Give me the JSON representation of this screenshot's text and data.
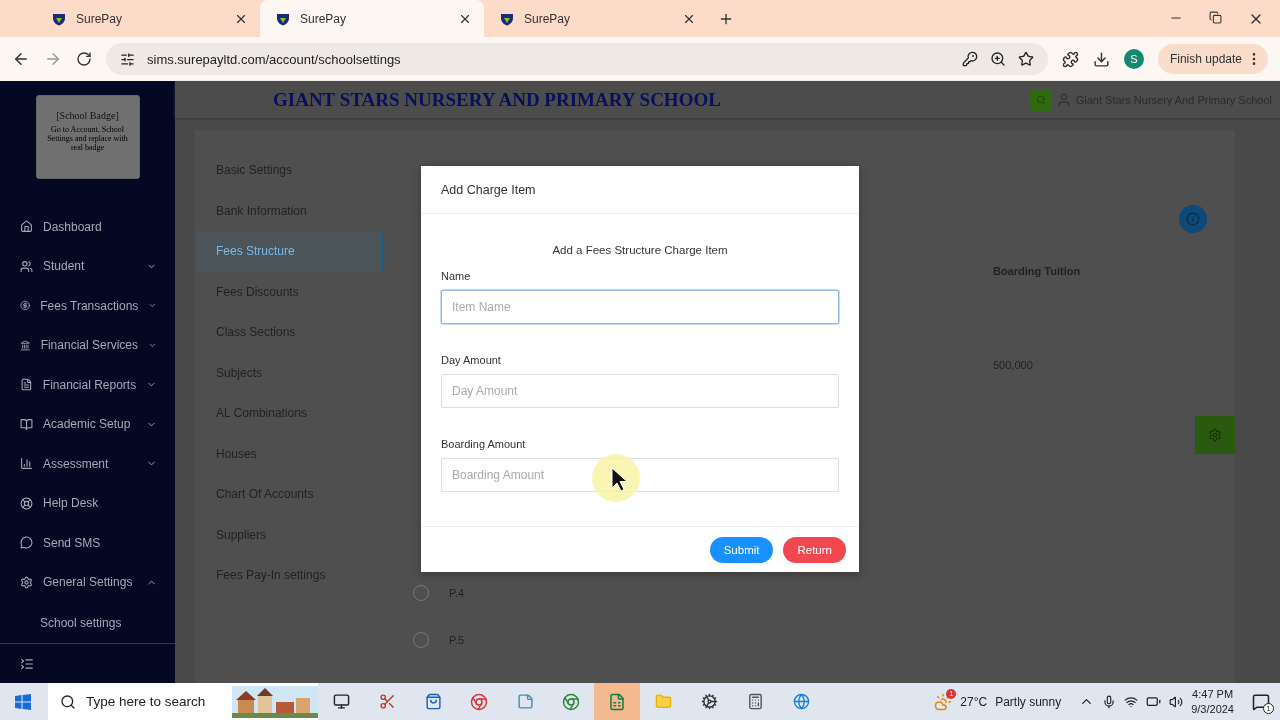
{
  "browser": {
    "tabs": [
      {
        "title": "SurePay",
        "selected": false
      },
      {
        "title": "SurePay",
        "selected": true
      },
      {
        "title": "SurePay",
        "selected": false
      }
    ],
    "url": "sims.surepayltd.com/account/schoolsettings",
    "profile_initial": "S",
    "update_button": "Finish update"
  },
  "sidebar": {
    "badge": {
      "title": "[School Badge]",
      "text": "Go to Account, School Settings and replace with real badge"
    },
    "items": [
      {
        "label": "Dashboard",
        "kind": "link"
      },
      {
        "label": "Student",
        "kind": "group",
        "expanded": false
      },
      {
        "label": "Fees Transactions",
        "kind": "group",
        "expanded": false
      },
      {
        "label": "Financial Services",
        "kind": "group",
        "expanded": false
      },
      {
        "label": "Financial Reports",
        "kind": "group",
        "expanded": false
      },
      {
        "label": "Academic Setup",
        "kind": "group",
        "expanded": false
      },
      {
        "label": "Assessment",
        "kind": "group",
        "expanded": false
      },
      {
        "label": "Help Desk",
        "kind": "link"
      },
      {
        "label": "Send SMS",
        "kind": "link"
      },
      {
        "label": "General Settings",
        "kind": "group",
        "expanded": true,
        "children": [
          {
            "label": "School settings"
          }
        ]
      }
    ]
  },
  "header": {
    "title": "GIANT STARS NURSERY AND PRIMARY SCHOOL",
    "user": "Giant Stars Nursery And Primary School"
  },
  "settings_menu": [
    {
      "label": "Basic Settings",
      "selected": false
    },
    {
      "label": "Bank Information",
      "selected": false
    },
    {
      "label": "Fees Structure",
      "selected": true
    },
    {
      "label": "Fees Discounts",
      "selected": false
    },
    {
      "label": "Class Sections",
      "selected": false
    },
    {
      "label": "Subjects",
      "selected": false
    },
    {
      "label": "AL Combinations",
      "selected": false
    },
    {
      "label": "Houses",
      "selected": false
    },
    {
      "label": "Chart Of Accounts",
      "selected": false
    },
    {
      "label": "Suppliers",
      "selected": false
    },
    {
      "label": "Fees Pay-In settings",
      "selected": false
    }
  ],
  "table": {
    "column_header": "Boarding Tuition",
    "value": "500,000",
    "rows": [
      {
        "label": "P.4",
        "selected": false
      },
      {
        "label": "P.5",
        "selected": false
      }
    ]
  },
  "modal": {
    "title": "Add Charge Item",
    "subtitle": "Add a Fees Structure Charge Item",
    "fields": [
      {
        "label": "Name",
        "placeholder": "Item Name",
        "focused": true
      },
      {
        "label": "Day Amount",
        "placeholder": "Day Amount",
        "focused": false
      },
      {
        "label": "Boarding Amount",
        "placeholder": "Boarding Amount",
        "focused": false
      }
    ],
    "buttons": [
      {
        "label": "Submit",
        "kind": "primary"
      },
      {
        "label": "Return",
        "kind": "danger"
      }
    ]
  },
  "taskbar": {
    "search_placeholder": "Type here to search",
    "weather_badge": "1",
    "temperature": "27°C",
    "condition": "Partly sunny",
    "time": "4:47 PM",
    "date": "9/3/2024",
    "notification_count": "1"
  }
}
